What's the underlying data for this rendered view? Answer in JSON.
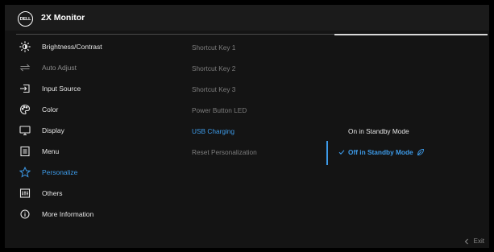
{
  "header": {
    "logo_text": "DELL",
    "title": "2X Monitor"
  },
  "menu": {
    "items": [
      {
        "label": "Brightness/Contrast",
        "icon": "brightness-icon",
        "state": "normal"
      },
      {
        "label": "Auto Adjust",
        "icon": "auto-adjust-icon",
        "state": "dim"
      },
      {
        "label": "Input Source",
        "icon": "input-source-icon",
        "state": "normal"
      },
      {
        "label": "Color",
        "icon": "palette-icon",
        "state": "normal"
      },
      {
        "label": "Display",
        "icon": "display-icon",
        "state": "normal"
      },
      {
        "label": "Menu",
        "icon": "menu-icon",
        "state": "normal"
      },
      {
        "label": "Personalize",
        "icon": "star-icon",
        "state": "active"
      },
      {
        "label": "Others",
        "icon": "others-icon",
        "state": "normal"
      },
      {
        "label": "More Information",
        "icon": "info-icon",
        "state": "normal"
      }
    ]
  },
  "submenu": {
    "items": [
      {
        "label": "Shortcut Key 1",
        "state": "normal"
      },
      {
        "label": "Shortcut Key 2",
        "state": "normal"
      },
      {
        "label": "Shortcut Key 3",
        "state": "normal"
      },
      {
        "label": "Power Button LED",
        "state": "normal"
      },
      {
        "label": "USB Charging",
        "state": "active"
      },
      {
        "label": "Reset Personalization",
        "state": "normal"
      }
    ]
  },
  "options": {
    "items": [
      {
        "label": "On in Standby Mode",
        "selected": false
      },
      {
        "label": "Off in Standby Mode",
        "selected": true
      }
    ]
  },
  "footer": {
    "exit_label": "Exit"
  },
  "colors": {
    "accent": "#3d9be9",
    "background": "#141414",
    "text": "#e6e6e6",
    "dim_text": "#7d7d7d"
  }
}
